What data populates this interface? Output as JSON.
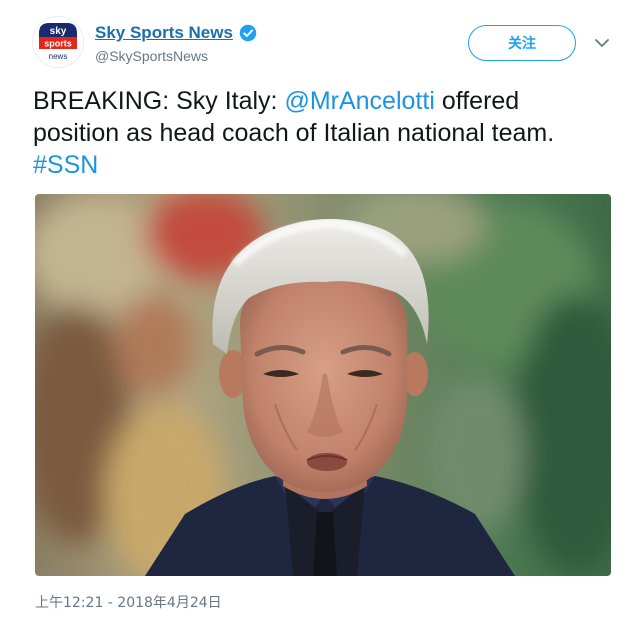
{
  "account": {
    "display_name": "Sky Sports News",
    "handle": "@SkySportsNews",
    "verified": true,
    "avatar_logo": {
      "line1": "sky",
      "line2": "sports",
      "line3": "news"
    }
  },
  "actions": {
    "follow_label": "关注",
    "more_icon": "chevron-down-icon"
  },
  "tweet": {
    "text_before": "BREAKING: Sky Italy: ",
    "mention": "@MrAncelotti",
    "text_after": " offered position as head coach of Italian national team. ",
    "hashtag": "#SSN",
    "timestamp": "上午12:21 - 2018年4月24日"
  },
  "colors": {
    "link": "#1b95e0",
    "name": "#1b6fae",
    "follow_accent": "#1da1f2",
    "sky_red": "#e1261c",
    "sky_navy": "#1a2a6c"
  }
}
